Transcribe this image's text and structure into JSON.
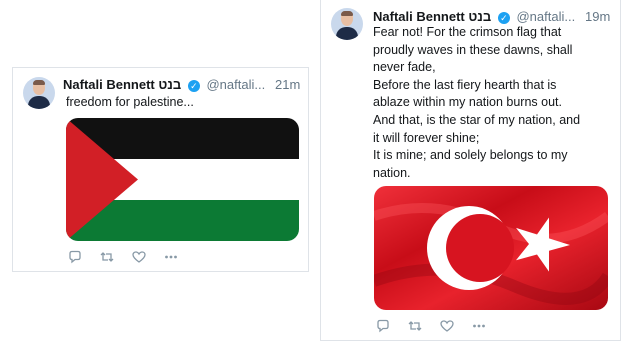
{
  "tweet_left": {
    "author_name": "Naftali Bennett",
    "author_hebrew": "בנט",
    "handle": "@naftali...",
    "time": "21m",
    "text": "freedom for palestine...",
    "media": "palestinian-flag"
  },
  "tweet_right": {
    "author_name": "Naftali Bennett",
    "author_hebrew": "בנט",
    "handle": "@naftali...",
    "time": "19m",
    "lines": [
      "Fear not! For the crimson flag that",
      "proudly waves in these dawns, shall",
      "never fade,",
      "Before the last fiery hearth that is",
      "ablaze within my nation burns out.",
      "And that, is the star of my nation, and",
      "it will forever shine;",
      "It is mine; and solely belongs to my",
      "nation."
    ],
    "media": "turkish-flag"
  },
  "icons": [
    "reply-icon",
    "retweet-icon",
    "like-icon",
    "more-icon"
  ],
  "colors": {
    "verified": "#1da1f2",
    "muted": "#657786",
    "palestine_red": "#d21f26",
    "palestine_green": "#0c7a34",
    "turkey_red": "#e30a17"
  }
}
